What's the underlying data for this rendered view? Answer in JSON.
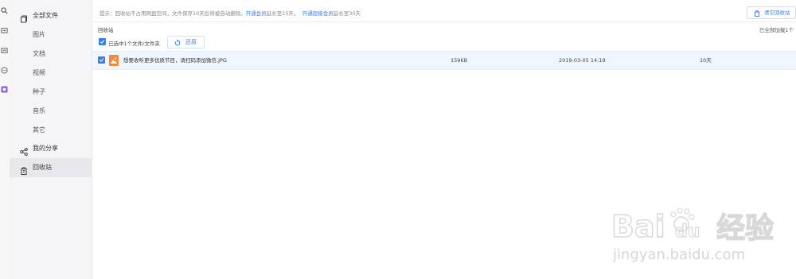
{
  "sidebar": {
    "all_files": "全部文件",
    "items": [
      "图片",
      "文档",
      "视频",
      "种子",
      "音乐",
      "其它"
    ],
    "my_share": "我的分享",
    "recycle_bin": "回收站"
  },
  "header": {
    "tip_prefix": "提示：回收站不占用网盘空间，文件保存10天后将被自动删除。",
    "link_vip": "开通会员",
    "tip_vip": "延长至15天，",
    "link_svip": "开通超级会员",
    "tip_svip": "延长至30天",
    "clear_button": "清空回收站"
  },
  "breadcrumb": "回收站",
  "loaded_status": "已全部加载1个",
  "selection": {
    "text": "已选中1个文件/文件夹",
    "restore_button": "还原"
  },
  "files": [
    {
      "name": "想要收听更多优质节目，请扫码添加微信.JPG",
      "size": "159KB",
      "deleted_time": "2019-03-05 14:19",
      "days_left": "10天",
      "icon": "image-file-icon"
    }
  ],
  "watermark": {
    "brand_a": "Bai",
    "brand_b": "du",
    "brand_cn": "经验",
    "url": "jingyan.baidu.com"
  },
  "colors": {
    "accent": "#3b7ee6",
    "file_icon": "#f08a3c",
    "selected_row": "#f0f6fe",
    "sidebar_bg": "#f5f5f7"
  }
}
